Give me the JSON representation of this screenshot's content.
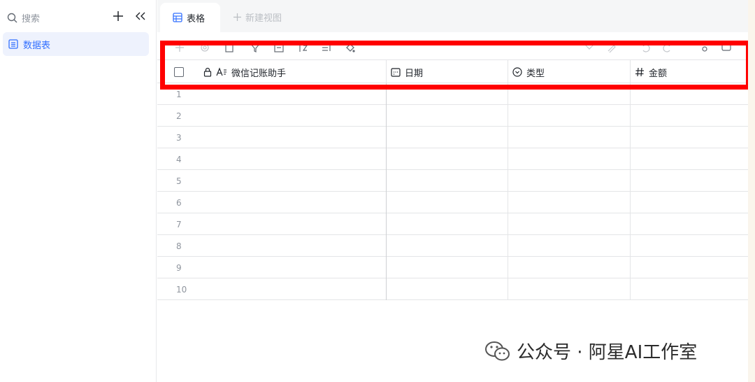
{
  "sidebar": {
    "search_placeholder": "搜索",
    "items": [
      {
        "label": "数据表"
      }
    ]
  },
  "tabs": {
    "active_label": "表格",
    "new_view_label": "新建视图"
  },
  "table": {
    "columns": [
      {
        "label": "微信记账助手",
        "type_icon": "text-icon"
      },
      {
        "label": "日期",
        "type_icon": "date-icon"
      },
      {
        "label": "类型",
        "type_icon": "select-icon"
      },
      {
        "label": "金额",
        "type_icon": "number-icon"
      }
    ],
    "row_numbers": [
      "1",
      "2",
      "3",
      "4",
      "5",
      "6",
      "7",
      "8",
      "9",
      "10"
    ]
  },
  "watermark": {
    "text": "公众号 · 阿星AI工作室"
  },
  "colors": {
    "accent": "#3370ff",
    "highlight": "#ff0000"
  }
}
